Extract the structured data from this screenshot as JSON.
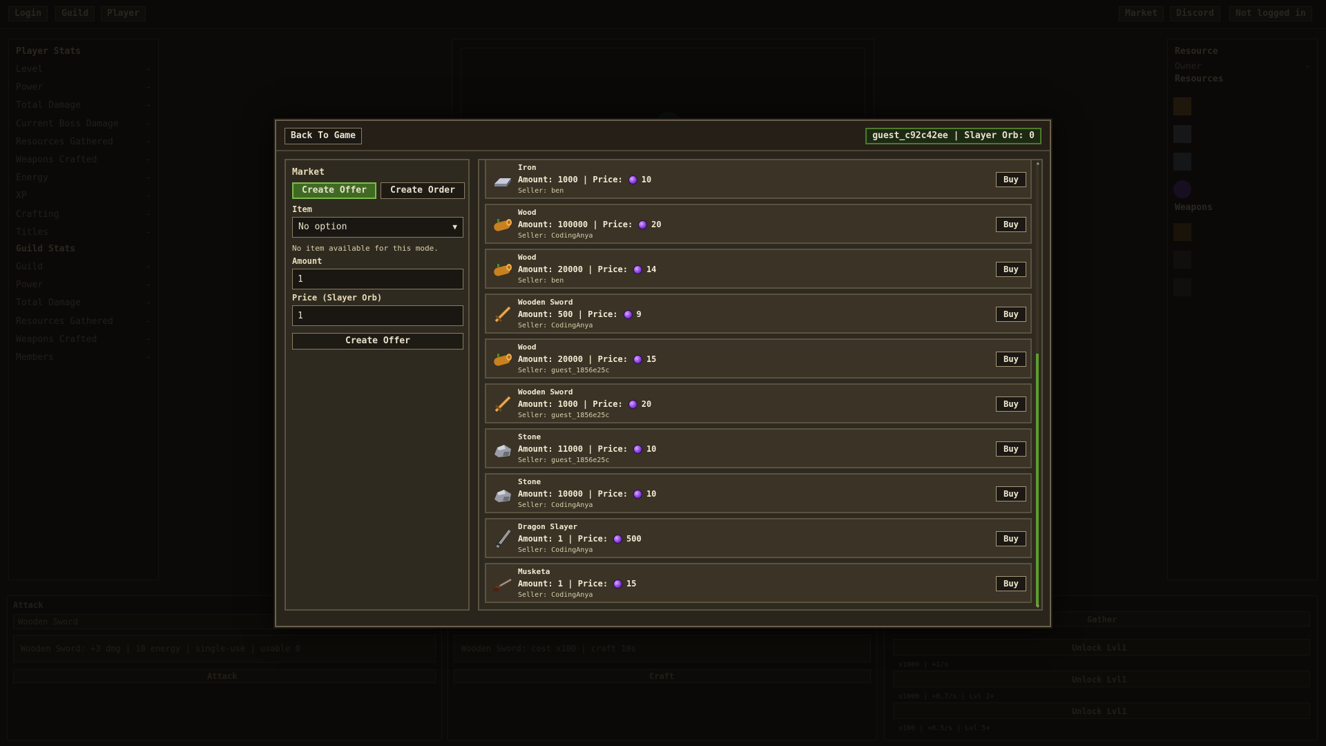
{
  "background": {
    "topbar_left": [
      "Login",
      "Guild",
      "Player"
    ],
    "topbar_right": [
      "Market",
      "Discord",
      "Not logged in"
    ],
    "player_stats_title": "Player Stats",
    "player_stats": [
      "Level",
      "Power",
      "Total Damage",
      "Current Boss Damage",
      "Resources Gathered",
      "Weapons Crafted",
      "Energy",
      "XP",
      "Crafting",
      "Titles"
    ],
    "guild_stats_title": "Guild Stats",
    "guild_stats": [
      "Guild",
      "Power",
      "Total Damage",
      "Resources Gathered",
      "Weapons Crafted",
      "Members"
    ],
    "stat_value": "-",
    "resource_title": "Resource",
    "owner_label": "Owner",
    "resources_title": "Resources",
    "weapons_title": "Weapons",
    "attack_title": "Attack",
    "attack_weapon": "Wooden Sword",
    "attack_desc": "Wooden Sword: +3 dmg | 10 energy | single-use | usable 0",
    "attack_button": "Attack",
    "craft_desc": "Wooden Sword: cost  x100 | craft 10s",
    "craft_button": "Craft",
    "gather_title": "Gather",
    "unlock_label": "Unlock Lvl1",
    "gather_info": [
      "x1000 | +1/s",
      "x1000 | +0.7/s | Lvl 2+",
      "x100 | +0.5/s | Lvl 5+"
    ]
  },
  "modal": {
    "back_button": "Back To Game",
    "user_badge": "guest_c92c42ee | Slayer Orb: 0",
    "form": {
      "title": "Market",
      "mode_offer": "Create Offer",
      "mode_order": "Create Order",
      "item_label": "Item",
      "item_value": "No option",
      "hint": "No item available for this mode.",
      "amount_label": "Amount",
      "amount_value": "1",
      "price_label": "Price (Slayer Orb)",
      "price_value": "1",
      "submit_button": "Create Offer"
    },
    "listings": [
      {
        "name": "Iron",
        "amount": "Amount: 1000 | Price:",
        "price": "10",
        "seller": "Seller: ben",
        "icon": "iron-ingot-icon"
      },
      {
        "name": "Wood",
        "amount": "Amount: 100000 | Price:",
        "price": "20",
        "seller": "Seller: CodingAnya",
        "icon": "wood-log-icon"
      },
      {
        "name": "Wood",
        "amount": "Amount: 20000 | Price:",
        "price": "14",
        "seller": "Seller: ben",
        "icon": "wood-log-icon"
      },
      {
        "name": "Wooden Sword",
        "amount": "Amount: 500 | Price:",
        "price": "9",
        "seller": "Seller: CodingAnya",
        "icon": "wooden-sword-icon"
      },
      {
        "name": "Wood",
        "amount": "Amount: 20000 | Price:",
        "price": "15",
        "seller": "Seller: guest_1856e25c",
        "icon": "wood-log-icon"
      },
      {
        "name": "Wooden Sword",
        "amount": "Amount: 1000 | Price:",
        "price": "20",
        "seller": "Seller: guest_1856e25c",
        "icon": "wooden-sword-icon"
      },
      {
        "name": "Stone",
        "amount": "Amount: 11000 | Price:",
        "price": "10",
        "seller": "Seller: guest_1856e25c",
        "icon": "stone-icon"
      },
      {
        "name": "Stone",
        "amount": "Amount: 10000 | Price:",
        "price": "10",
        "seller": "Seller: CodingAnya",
        "icon": "stone-icon"
      },
      {
        "name": "Dragon Slayer",
        "amount": "Amount: 1 | Price:",
        "price": "500",
        "seller": "Seller: CodingAnya",
        "icon": "dragon-slayer-sword-icon"
      },
      {
        "name": "Musketa",
        "amount": "Amount: 1 | Price:",
        "price": "15",
        "seller": "Seller: CodingAnya",
        "icon": "musket-icon"
      }
    ],
    "buy_label": "Buy"
  },
  "colors": {
    "accent_green": "#7cbd4a",
    "orb_purple": "#8b3ee0",
    "panel_border": "#5b5240"
  }
}
